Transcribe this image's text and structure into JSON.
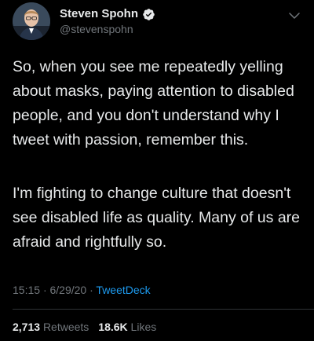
{
  "author": {
    "display_name": "Steven Spohn",
    "handle": "@stevenspohn",
    "verified": true
  },
  "tweet": {
    "paragraphs": [
      "So, when you see me repeatedly yelling about masks, paying attention to disabled people, and you don't understand why I tweet with passion, remember this.",
      "I'm fighting to change culture that doesn't see disabled life as quality. Many of us are afraid and rightfully so."
    ]
  },
  "meta": {
    "time": "15:15",
    "separator": "·",
    "date": "6/29/20",
    "source": "TweetDeck"
  },
  "stats": {
    "retweets_count": "2,713",
    "retweets_label": "Retweets",
    "likes_count": "18.6K",
    "likes_label": "Likes"
  },
  "colors": {
    "background": "#000000",
    "primary_text": "#e7e9ea",
    "secondary_text": "#71767b",
    "accent": "#1d9bf0",
    "divider": "#2f3336"
  },
  "icons": {
    "verified": "verified-badge-icon",
    "more": "chevron-down-icon"
  }
}
